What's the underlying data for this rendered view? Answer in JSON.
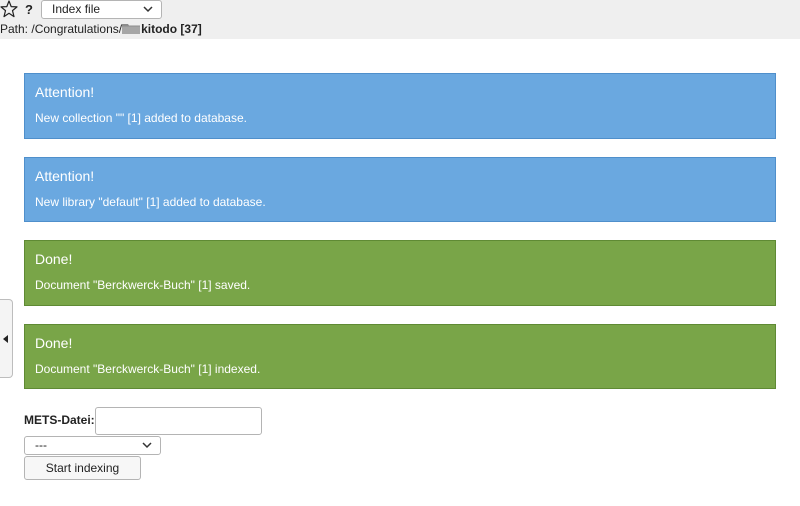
{
  "toolbar": {
    "star_icon": "star-outline-icon",
    "help_label": "?",
    "function_select_value": "Index file"
  },
  "path": {
    "prefix": "Path: /Congratulations/",
    "folder_icon": "folder-icon",
    "current": "kitodo",
    "id": "[37]"
  },
  "messages": [
    {
      "type": "info",
      "title": "Attention!",
      "text": "New collection \"\" [1] added to database."
    },
    {
      "type": "info",
      "title": "Attention!",
      "text": "New library \"default\" [1] added to database."
    },
    {
      "type": "success",
      "title": "Done!",
      "text": "Document \"Berckwerck-Buch\" [1] saved."
    },
    {
      "type": "success",
      "title": "Done!",
      "text": "Document \"Berckwerck-Buch\" [1] indexed."
    }
  ],
  "form": {
    "mets_label": "METS-Datei:",
    "mets_value": "",
    "library_select_value": "---",
    "submit_label": "Start indexing"
  },
  "colors": {
    "info": "#6aa8e0",
    "success": "#79a548",
    "toolbar_bg": "#efefef"
  }
}
